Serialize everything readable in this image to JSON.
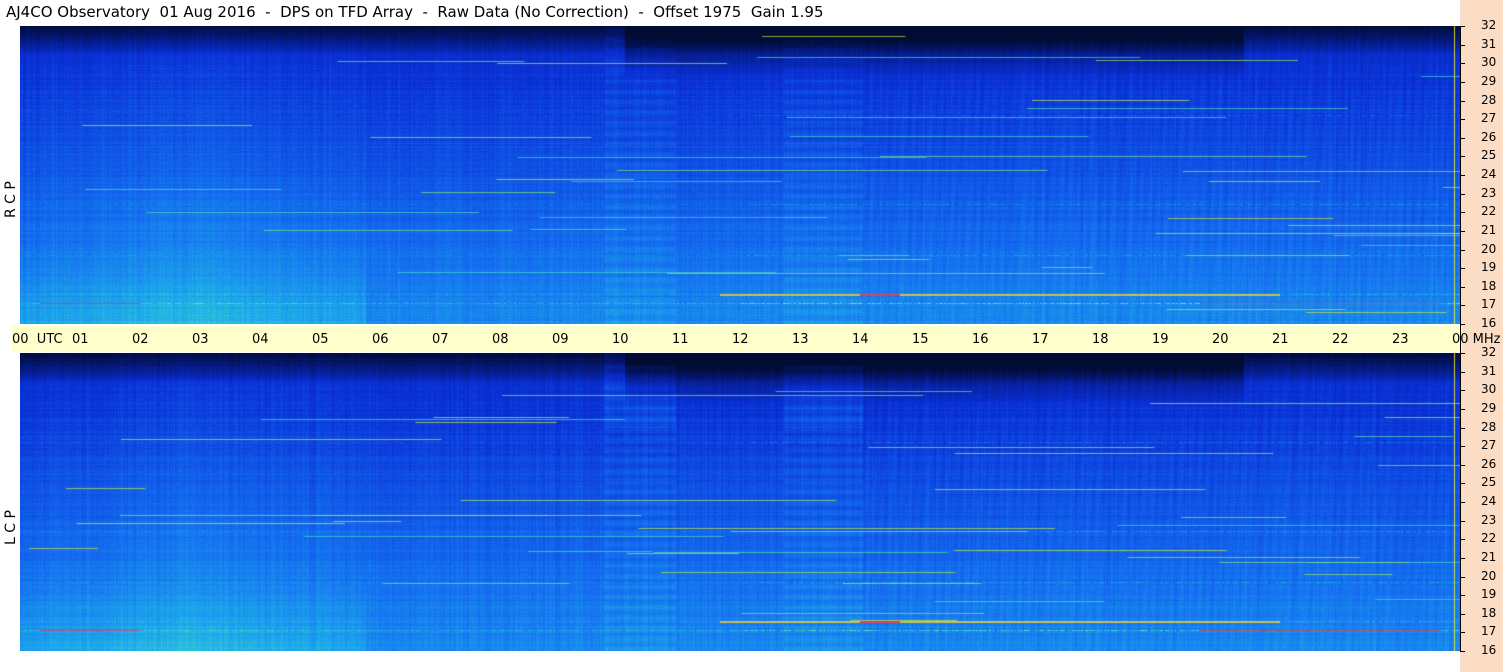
{
  "header": {
    "title": "AJ4CO Observatory  01 Aug 2016  -  DPS on TFD Array  -  Raw Data (No Correction)  -  Offset 1975  Gain 1.95"
  },
  "chart_data": {
    "type": "heatmap",
    "title": "AJ4CO Observatory  01 Aug 2016  -  DPS on TFD Array  -  Raw Data (No Correction)  -  Offset 1975  Gain 1.95",
    "x_axis": {
      "unit_label": "UTC",
      "ticks": [
        "00",
        "01",
        "02",
        "03",
        "04",
        "05",
        "06",
        "07",
        "08",
        "09",
        "10",
        "11",
        "12",
        "13",
        "14",
        "15",
        "16",
        "17",
        "18",
        "19",
        "20",
        "21",
        "22",
        "23",
        "00"
      ],
      "range": [
        0,
        24
      ]
    },
    "y_axis": {
      "unit_label": "MHz",
      "ticks": [
        "32",
        "31",
        "30",
        "29",
        "28",
        "27",
        "26",
        "25",
        "24",
        "23",
        "22",
        "21",
        "20",
        "19",
        "18",
        "17",
        "16"
      ],
      "range": [
        16,
        32
      ]
    },
    "panels": [
      {
        "label": "R C P"
      },
      {
        "label": "L C P"
      }
    ],
    "colors": {
      "deep": "#02124a",
      "low": "#0a30d8",
      "mid": "#1a78f0",
      "high": "#23c8e8",
      "hot": "#e8e020",
      "peak": "#e82050"
    }
  },
  "axis_text": {
    "utc": "00  UTC",
    "mhz_end": "00 MHz"
  }
}
